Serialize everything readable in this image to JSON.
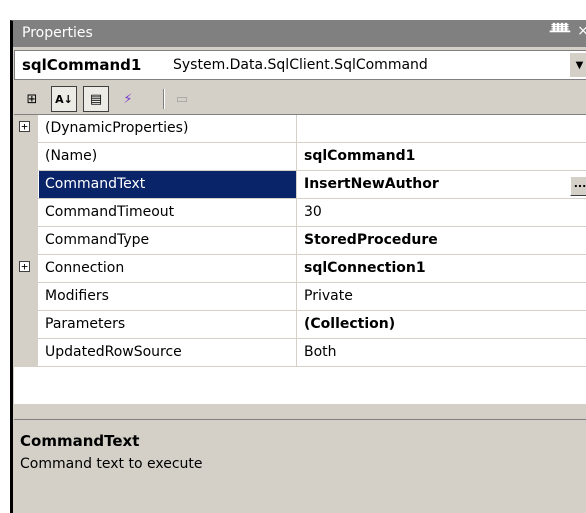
{
  "window": {
    "title": "Properties",
    "pin_glyph": "ᚙ",
    "close_glyph": "×"
  },
  "object_selector": {
    "name": "sqlCommand1",
    "type": "System.Data.SqlClient.SqlCommand"
  },
  "toolbar": {
    "buttons": [
      {
        "icon": "categorized-icon",
        "glyph": "⊞",
        "pressed": false
      },
      {
        "icon": "alphabetical-icon",
        "glyph": "A↓",
        "pressed": true
      },
      {
        "icon": "properties-icon",
        "glyph": "▤",
        "pressed": true
      },
      {
        "icon": "events-icon",
        "glyph": "⚡",
        "pressed": false
      },
      {
        "icon": "property-pages-icon",
        "glyph": "▭",
        "pressed": false
      }
    ]
  },
  "grid": {
    "rows": [
      {
        "name": "(DynamicProperties)",
        "value": "",
        "expandable": true,
        "bold": false,
        "selected": false
      },
      {
        "name": "(Name)",
        "value": "sqlCommand1",
        "expandable": false,
        "bold": true,
        "selected": false
      },
      {
        "name": "CommandText",
        "value": "InsertNewAuthor",
        "expandable": false,
        "bold": true,
        "selected": true
      },
      {
        "name": "CommandTimeout",
        "value": "30",
        "expandable": false,
        "bold": false,
        "selected": false
      },
      {
        "name": "CommandType",
        "value": "StoredProcedure",
        "expandable": false,
        "bold": true,
        "selected": false
      },
      {
        "name": "Connection",
        "value": "sqlConnection1",
        "expandable": true,
        "bold": true,
        "selected": false
      },
      {
        "name": "Modifiers",
        "value": "Private",
        "expandable": false,
        "bold": false,
        "selected": false
      },
      {
        "name": "Parameters",
        "value": "(Collection)",
        "expandable": false,
        "bold": true,
        "selected": false
      },
      {
        "name": "UpdatedRowSource",
        "value": "Both",
        "expandable": false,
        "bold": false,
        "selected": false
      }
    ],
    "ellipsis_label": "..."
  },
  "description": {
    "title": "CommandText",
    "text": "Command text to execute"
  },
  "colors": {
    "selection": "#0a246a",
    "chrome": "#d4d0c8",
    "titlebar": "#808080"
  }
}
